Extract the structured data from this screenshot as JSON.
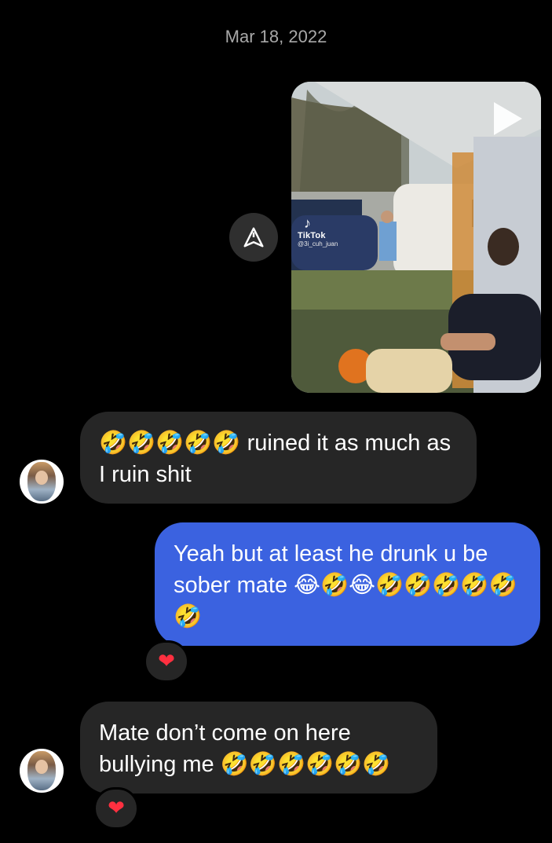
{
  "thread": {
    "date": "Mar 18, 2022"
  },
  "video": {
    "tiktok_brand": "TikTok",
    "tiktok_handle": "@3i_cuh_juan",
    "play_icon": "play-icon",
    "share_icon": "send-icon"
  },
  "messages": [
    {
      "sender": "other",
      "emoji_prefix": "🤣🤣🤣🤣🤣",
      "text": "ruined it as much as I ruin shit"
    },
    {
      "sender": "me",
      "text_line1": "Yeah but at least he drunk u be",
      "text_line2": "sober mate",
      "emoji_suffix": "😂🤣😂🤣🤣🤣🤣🤣🤣",
      "reaction": "❤"
    },
    {
      "sender": "other",
      "text_line1": "Mate don’t come on here",
      "text_line2": "bullying me",
      "emoji_suffix": "🤣🤣🤣🤣🤣🤣",
      "reaction": "❤"
    }
  ],
  "colors": {
    "background": "#000000",
    "incoming_bubble": "#262626",
    "outgoing_bubble": "#3b62e0",
    "heart": "#ff3040",
    "date_text": "#a8a8a8"
  }
}
